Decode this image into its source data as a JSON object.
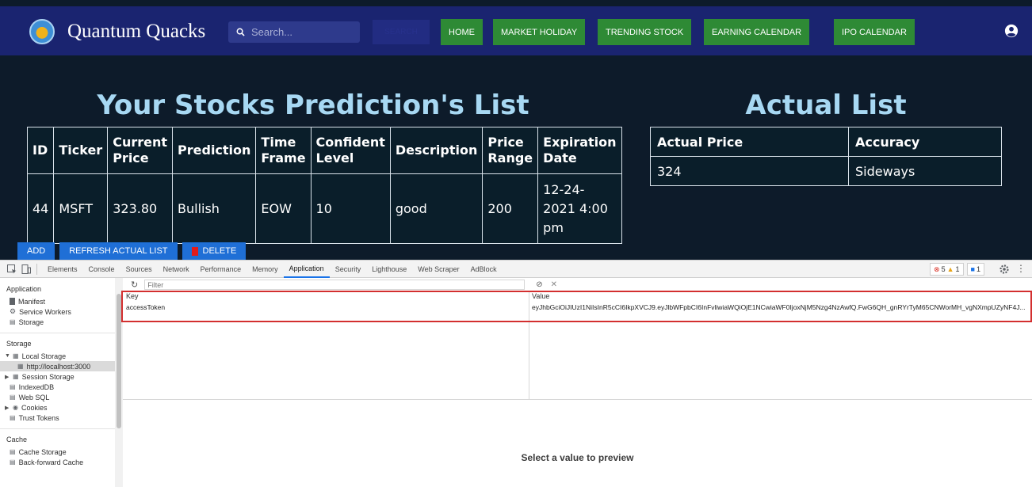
{
  "navbar": {
    "brand": "Quantum Quacks",
    "search_placeholder": "Search...",
    "search_button": "SEARCH",
    "buttons": [
      "HOME",
      "MARKET HOLIDAY",
      "TRENDING STOCK",
      "EARNING CALENDAR",
      "IPO CALENDAR"
    ]
  },
  "prediction": {
    "title": "Your Stocks Prediction's List",
    "columns": [
      "ID",
      "Ticker",
      "Current Price",
      "Prediction",
      "Time Frame",
      "Confident Level",
      "Description",
      "Price Range",
      "Expiration Date"
    ],
    "rows": [
      [
        "44",
        "MSFT",
        "323.80",
        "Bullish",
        "EOW",
        "10",
        "good",
        "200",
        "12-24-2021 4:00 pm"
      ]
    ]
  },
  "actual": {
    "title": "Actual List",
    "columns": [
      "Actual Price",
      "Accuracy"
    ],
    "rows": [
      [
        "324",
        "Sideways"
      ]
    ]
  },
  "actions": {
    "add": "ADD",
    "refresh": "REFRESH ACTUAL LIST",
    "delete": "DELETE"
  },
  "devtools": {
    "tabs": [
      "Elements",
      "Console",
      "Sources",
      "Network",
      "Performance",
      "Memory",
      "Application",
      "Security",
      "Lighthouse",
      "Web Scraper",
      "AdBlock"
    ],
    "active_tab": "Application",
    "badges": {
      "errors": "5",
      "warnings": "1",
      "messages": "1"
    },
    "sidebar": {
      "application_header": "Application",
      "application_items": [
        "Manifest",
        "Service Workers",
        "Storage"
      ],
      "storage_header": "Storage",
      "local_storage": "Local Storage",
      "local_storage_origin": "http://localhost:3000",
      "storage_items": [
        "Session Storage",
        "IndexedDB",
        "Web SQL",
        "Cookies",
        "Trust Tokens"
      ],
      "cache_header": "Cache",
      "cache_items": [
        "Cache Storage",
        "Back-forward Cache"
      ]
    },
    "filter_placeholder": "Filter",
    "kv_headers": {
      "key": "Key",
      "value": "Value"
    },
    "entries": [
      {
        "key": "accessToken",
        "value": "eyJhbGciOiJIUzI1NiIsInR5cCI6IkpXVCJ9.eyJlbWFpbCI6InFvliwiaWQiOjE1NCwiaWF0IjoxNjM5Nzg4NzAwfQ.FwG6QH_gnRYrTyM65CNWorMH_vgNXmpUZyNF4J..."
      }
    ],
    "preview_text": "Select a value to preview"
  },
  "colors": {
    "navbar": "#1a2470",
    "page_bg": "#0d1b2a",
    "nav_button": "#2e8a35",
    "title": "#a7d8f3",
    "action_button": "#1f6fd6",
    "highlight": "#d32f2f"
  }
}
